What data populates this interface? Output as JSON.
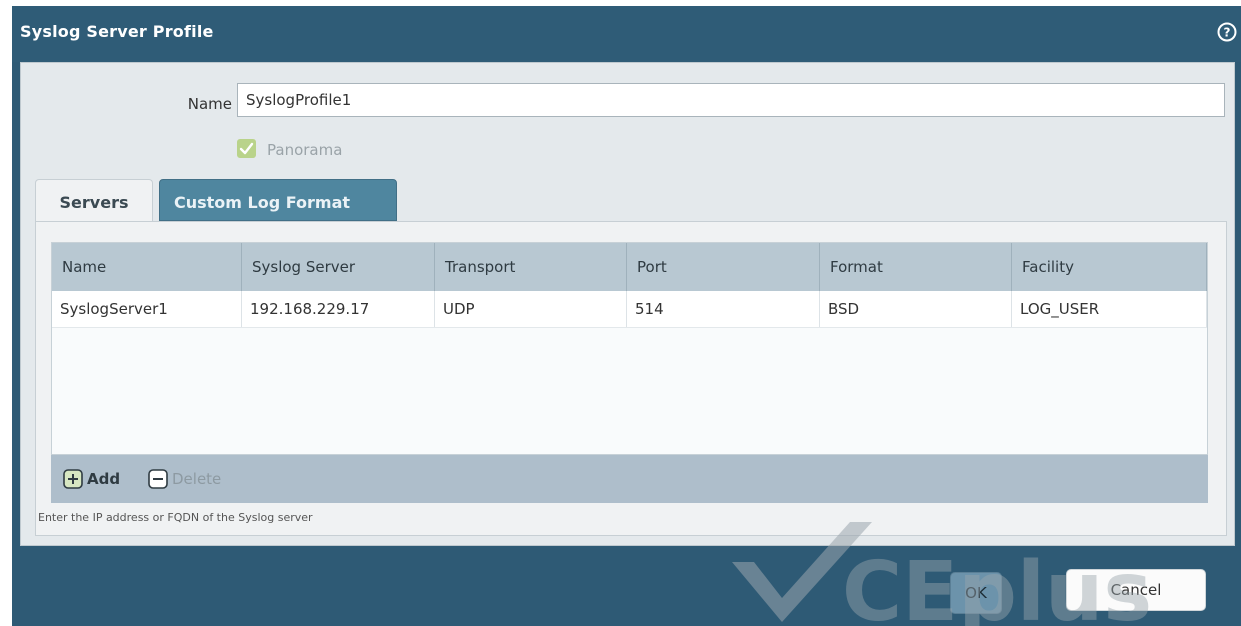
{
  "dialog": {
    "title": "Syslog Server Profile",
    "help_icon": "help-circle-icon"
  },
  "form": {
    "name_label": "Name",
    "name_value": "SyslogProfile1",
    "panorama_label": "Panorama",
    "panorama_checked": true
  },
  "tabs": [
    {
      "label": "Servers",
      "active": true
    },
    {
      "label": "Custom Log Format",
      "active": false
    }
  ],
  "table": {
    "columns": [
      "Name",
      "Syslog Server",
      "Transport",
      "Port",
      "Format",
      "Facility"
    ],
    "rows": [
      [
        "SyslogServer1",
        "192.168.229.17",
        "UDP",
        "514",
        "BSD",
        "LOG_USER"
      ]
    ]
  },
  "actions": {
    "add_label": "Add",
    "add_icon": "plus-square-icon",
    "delete_label": "Delete",
    "delete_icon": "minus-square-icon"
  },
  "hint": "Enter the IP address or FQDN of the Syslog server",
  "buttons": {
    "ok_label": "OK",
    "cancel_label": "Cancel"
  },
  "watermark": "CEplus",
  "colors": {
    "titlebar": "#2f5c77",
    "tab_inactive": "#4f869f",
    "grid_header": "#b8c8d2",
    "action_bar": "#aebecb",
    "checkbox": "#b9d38a"
  }
}
